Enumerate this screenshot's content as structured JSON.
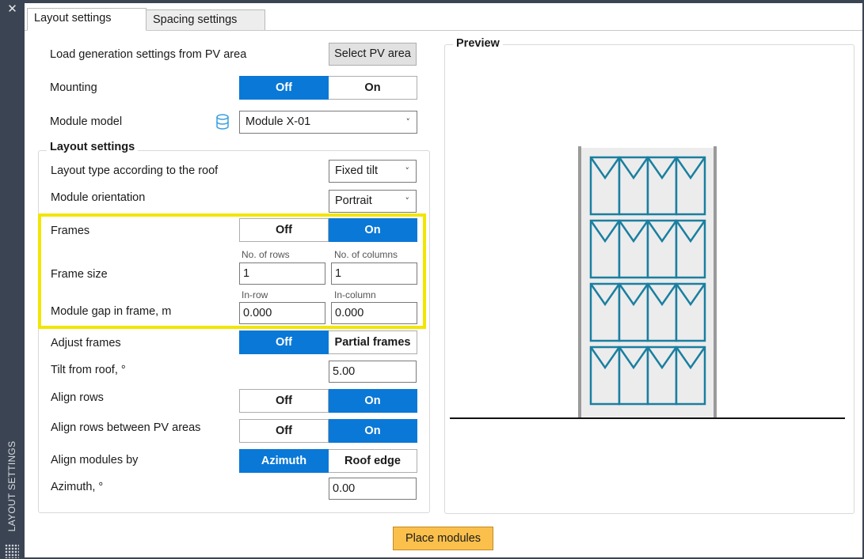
{
  "sidebar": {
    "title": "LAYOUT SETTINGS",
    "close_symbol": "✕"
  },
  "tabs": [
    {
      "label": "Layout settings",
      "active": true
    },
    {
      "label": "Spacing settings",
      "active": false
    }
  ],
  "load": {
    "label": "Load generation settings from PV area",
    "button": "Select PV area"
  },
  "mounting": {
    "label": "Mounting",
    "off": "Off",
    "on": "On",
    "selected": "off"
  },
  "module_model": {
    "label": "Module model",
    "value": "Module X-01"
  },
  "layout_group": {
    "title": "Layout settings",
    "layout_type": {
      "label": "Layout type according to the roof",
      "value": "Fixed tilt"
    },
    "orientation": {
      "label": "Module orientation",
      "value": "Portrait"
    },
    "frames": {
      "label": "Frames",
      "off": "Off",
      "on": "On",
      "selected": "on"
    },
    "frame_size": {
      "label": "Frame size",
      "rows_label": "No. of rows",
      "rows_value": "1",
      "cols_label": "No. of columns",
      "cols_value": "1"
    },
    "module_gap": {
      "label": "Module gap in frame,  m",
      "inrow_label": "In-row",
      "inrow_value": "0.000",
      "incol_label": "In-column",
      "incol_value": "0.000"
    },
    "adjust_frames": {
      "label": "Adjust frames",
      "off": "Off",
      "partial": "Partial frames",
      "selected": "off"
    },
    "tilt": {
      "label": "Tilt from roof, °",
      "value": "5.00"
    },
    "align_rows": {
      "label": "Align rows",
      "off": "Off",
      "on": "On",
      "selected": "on"
    },
    "align_rows_pv": {
      "label": "Align rows between PV areas",
      "off": "Off",
      "on": "On",
      "selected": "on"
    },
    "align_modules": {
      "label": "Align modules by",
      "azimuth": "Azimuth",
      "roof_edge": "Roof edge",
      "selected": "azimuth"
    },
    "azimuth": {
      "label": "Azimuth, °",
      "value": "0.00"
    }
  },
  "preview": {
    "title": "Preview",
    "rows": 4,
    "columns": 4,
    "module_color": "#1a7fa0"
  },
  "place_button": "Place modules",
  "colors": {
    "accent": "#0a78d7",
    "highlight": "#f2e600",
    "place_button": "#fbc04c",
    "sidebar": "#3b4453"
  }
}
